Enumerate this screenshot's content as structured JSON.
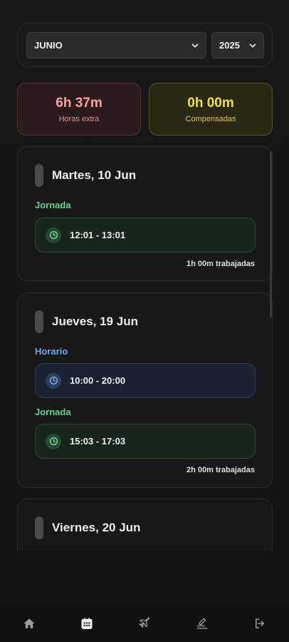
{
  "filters": {
    "month": {
      "selected": "JUNIO"
    },
    "year": {
      "selected": "2025"
    }
  },
  "summary": {
    "overtime": {
      "value": "6h 37m",
      "label": "Horas extra"
    },
    "compensated": {
      "value": "0h 00m",
      "label": "Compensadas"
    }
  },
  "days": [
    {
      "title": "Martes, 10 Jun",
      "jornada_label": "Jornada",
      "jornada_slot": "12:01 - 13:01",
      "worked": "1h 00m trabajadas"
    },
    {
      "title": "Jueves, 19 Jun",
      "horario_label": "Horario",
      "horario_slot": "10:00 - 20:00",
      "jornada_label": "Jornada",
      "jornada_slot": "15:03 - 17:03",
      "worked": "2h 00m trabajadas"
    },
    {
      "title": "Viernes, 20 Jun"
    }
  ],
  "colors": {
    "jornada": "#5fd38a",
    "horario": "#6ea8f3",
    "overtime": "#f8a3a3",
    "compensated": "#f4dc3c"
  },
  "tabbar": {
    "items": [
      {
        "icon": "home-icon",
        "active": false
      },
      {
        "icon": "calendar-icon",
        "active": true
      },
      {
        "icon": "plane-icon",
        "active": false
      },
      {
        "icon": "signature-icon",
        "active": false
      },
      {
        "icon": "logout-icon",
        "active": false
      }
    ]
  }
}
